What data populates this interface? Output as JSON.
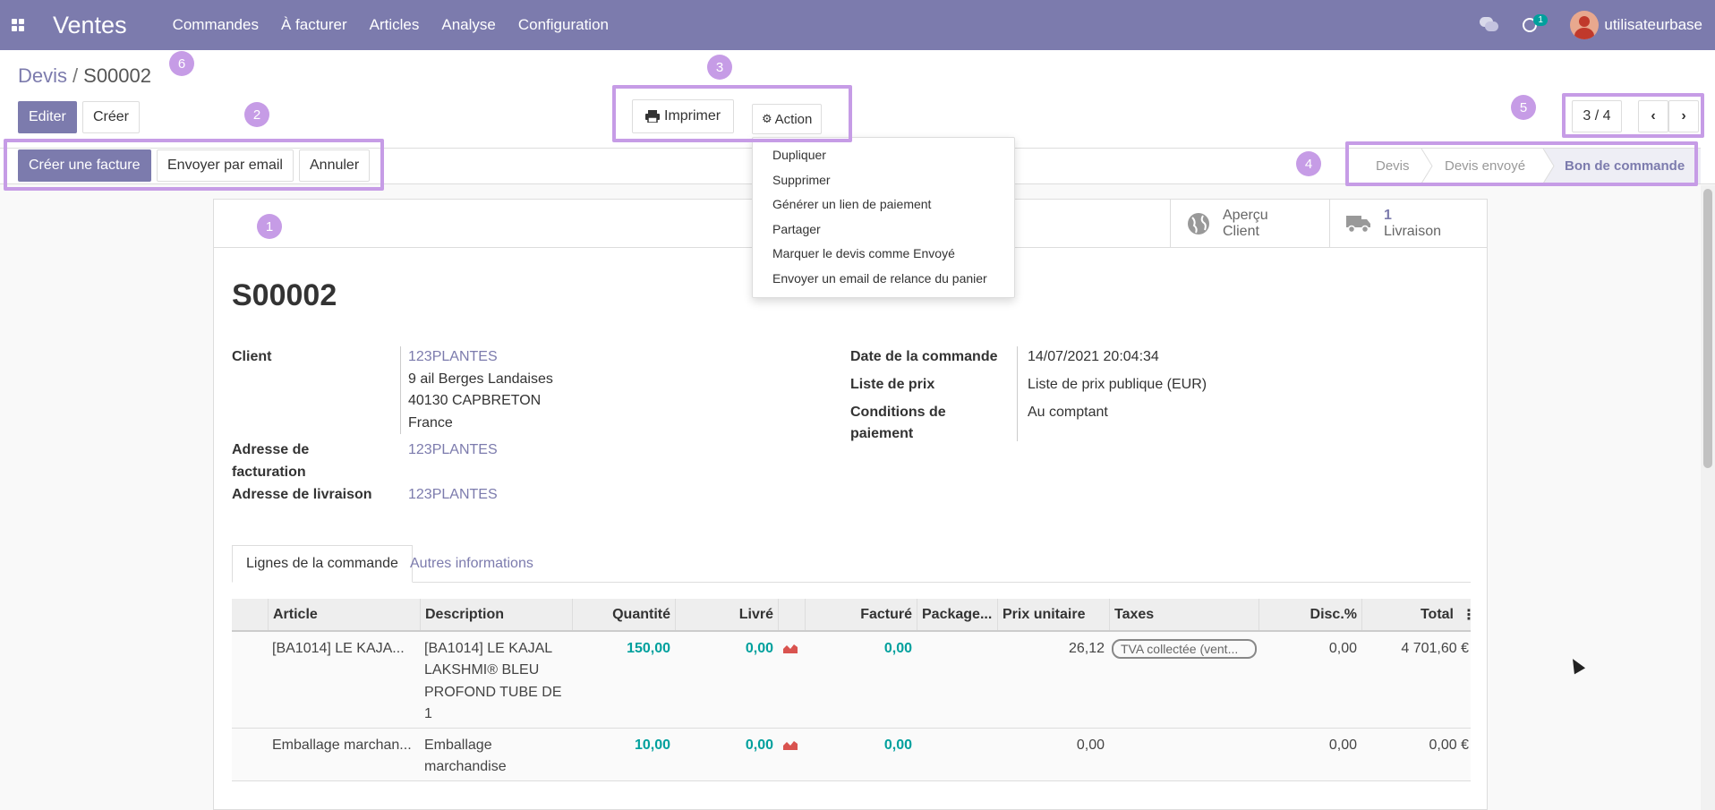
{
  "navbar": {
    "app_name": "Ventes",
    "menu": [
      "Commandes",
      "À facturer",
      "Articles",
      "Analyse",
      "Configuration"
    ],
    "activity_count": "1",
    "username": "utilisateurbase"
  },
  "breadcrumb": {
    "parent": "Devis",
    "separator": "/",
    "current": "S00002"
  },
  "buttons": {
    "edit": "Editer",
    "create": "Créer",
    "print": "Imprimer",
    "action": "Action",
    "create_invoice": "Créer une facture",
    "send_email": "Envoyer par email",
    "cancel": "Annuler"
  },
  "pager": {
    "text": "3 / 4"
  },
  "status_steps": [
    "Devis",
    "Devis envoyé",
    "Bon de commande"
  ],
  "markers": [
    "1",
    "2",
    "3",
    "4",
    "5",
    "6"
  ],
  "action_menu": [
    "Dupliquer",
    "Supprimer",
    "Générer un lien de paiement",
    "Partager",
    "Marquer le devis comme Envoyé",
    "Envoyer un email de relance du panier"
  ],
  "smart_buttons": {
    "preview": {
      "line1": "Aperçu",
      "line2": "Client"
    },
    "delivery": {
      "count": "1",
      "label": "Livraison"
    }
  },
  "record": {
    "name": "S00002",
    "client_label": "Client",
    "client_name": "123PLANTES",
    "client_address": [
      "9 ail Berges Landaises",
      "40130 CAPBRETON",
      "France"
    ],
    "invoice_address_label": [
      "Adresse de",
      "facturation"
    ],
    "invoice_address": "123PLANTES",
    "delivery_address_label": "Adresse de livraison",
    "delivery_address": "123PLANTES",
    "order_date_label": "Date de la commande",
    "order_date": "14/07/2021 20:04:34",
    "pricelist_label": "Liste de prix",
    "pricelist": "Liste de prix publique (EUR)",
    "payment_terms_label": [
      "Conditions de",
      "paiement"
    ],
    "payment_terms": "Au comptant"
  },
  "tabs": [
    "Lignes de la commande",
    "Autres informations"
  ],
  "table": {
    "headers": [
      "Article",
      "Description",
      "Quantité",
      "Livré",
      "Facturé",
      "Package...",
      "Prix unitaire",
      "Taxes",
      "Disc.%",
      "Total"
    ],
    "rows": [
      {
        "article": "[BA1014] LE KAJA...",
        "description": [
          "[BA1014] LE KAJAL",
          "LAKSHMI® BLEU",
          "PROFOND TUBE DE",
          "1"
        ],
        "quantity": "150,00",
        "delivered": "0,00",
        "invoiced": "0,00",
        "unit_price": "26,12",
        "taxes": "TVA collectée (vent...",
        "discount": "0,00",
        "total": "4 701,60 €"
      },
      {
        "article": "Emballage marchan...",
        "description": [
          "Emballage",
          "marchandise"
        ],
        "quantity": "10,00",
        "delivered": "0,00",
        "invoiced": "0,00",
        "unit_price": "0,00",
        "taxes": "",
        "discount": "0,00",
        "total": "0,00 €"
      }
    ]
  },
  "colors": {
    "primary": "#7c7bad",
    "highlight": "#c69ce6",
    "numeric": "#00a09d"
  }
}
